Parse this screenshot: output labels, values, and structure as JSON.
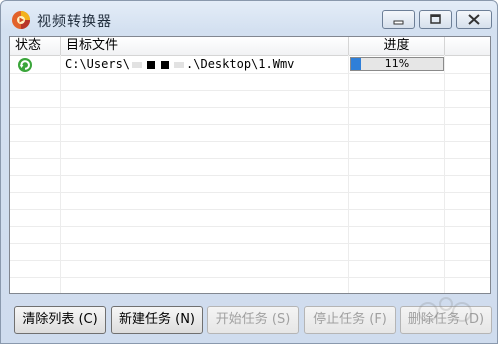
{
  "window": {
    "title": "视频转换器",
    "app_icon": "multicolor-app-icon",
    "controls": [
      "minimize-icon",
      "maximize-icon",
      "close-icon"
    ]
  },
  "list": {
    "columns": [
      "状态",
      "目标文件",
      "进度",
      ""
    ],
    "rows": [
      {
        "status_icon": "green-refresh-icon",
        "file_prefix": "C:\\Users\\",
        "file_suffix": ".\\Desktop\\1.Wmv",
        "progress_percent": 11,
        "progress_label": "11%"
      }
    ]
  },
  "buttons": {
    "clear_list": "清除列表 (C)",
    "new_task": "新建任务 (N)",
    "start_task": "开始任务 (S)",
    "stop_task": "停止任务 (F)",
    "delete_task": "删除任务 (D)"
  },
  "colors": {
    "progress_fill": "#2f7fd8",
    "titlebar": "#d3e0f0"
  }
}
